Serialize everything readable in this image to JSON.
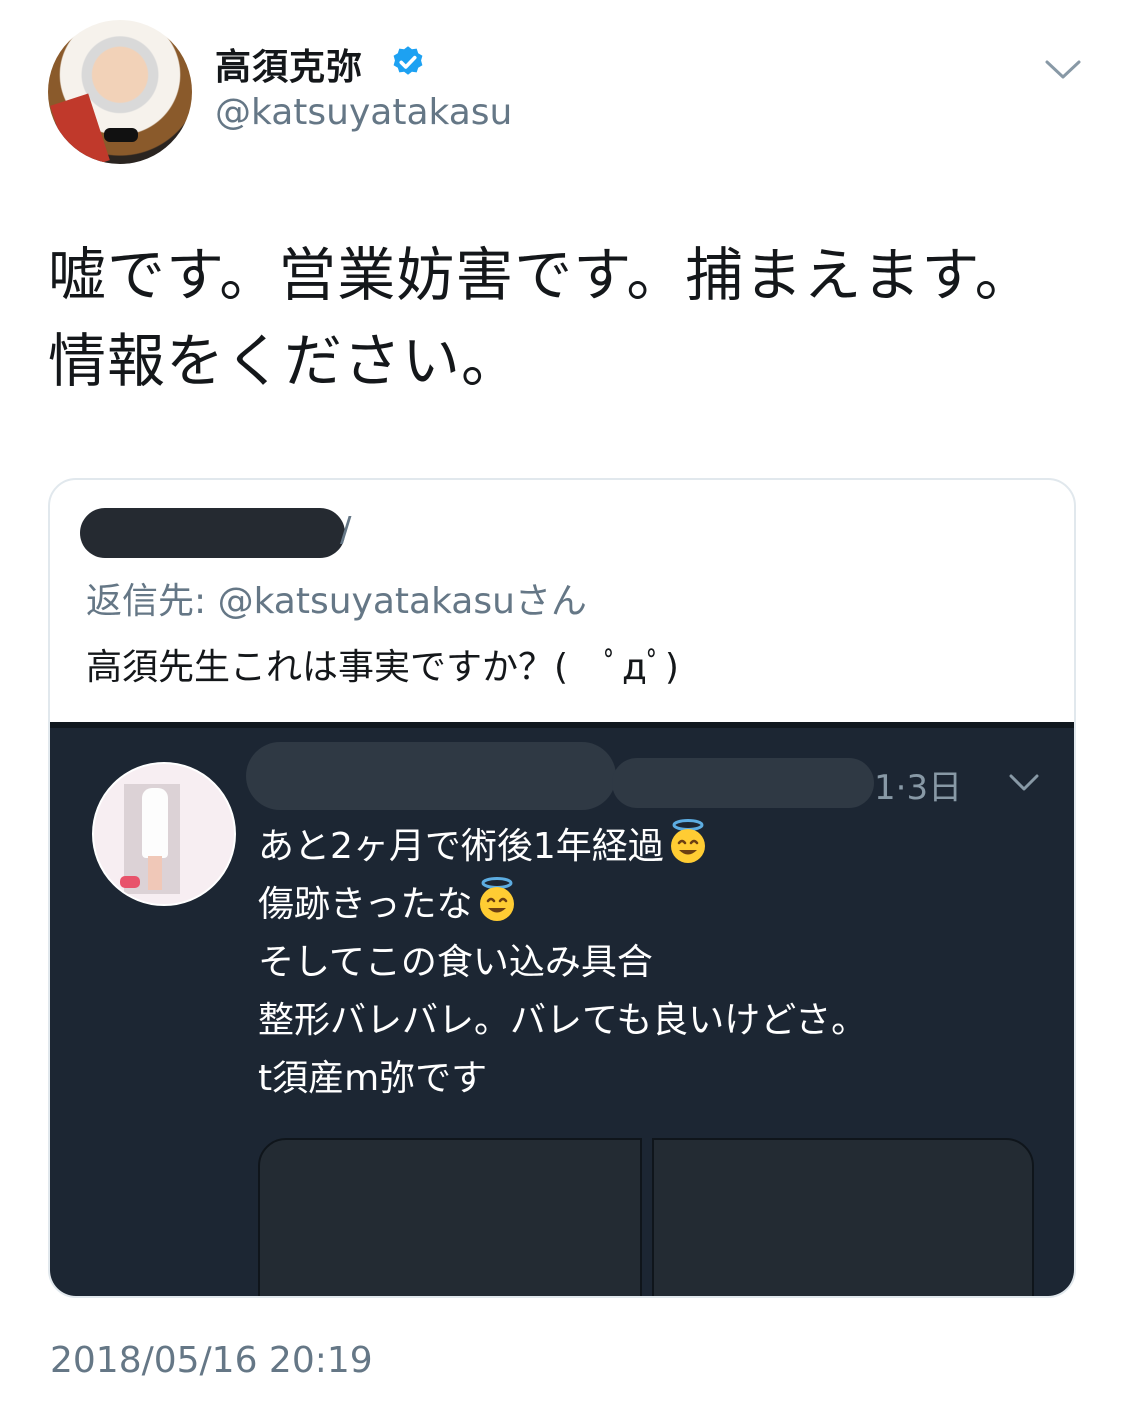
{
  "author": {
    "display_name": "高須克弥",
    "handle": "@katsuyatakasu",
    "verified": true,
    "avatar_icon": "profile-photo",
    "verified_icon": "verified-badge-icon",
    "menu_icon": "chevron-down-icon"
  },
  "tweet": {
    "text": "嘘です。営業妨害です。捕まえます。情報をください。",
    "timestamp": "2018/05/16 20:19"
  },
  "quoted": {
    "reply_to": "返信先: @katsuyatakasuさん",
    "text": "高須先生これは事実ですか？(　ﾟдﾟ)",
    "name_slash": "/",
    "embedded_post": {
      "meta": "1·3日",
      "lines": [
        "あと2ヶ月で術後1年経過",
        "傷跡きったな",
        "そしてこの食い込み具合",
        "整形バレバレ。バレても良いけどさ。",
        "t須産m弥です"
      ],
      "emoji": "smiling-face-with-halo"
    }
  },
  "colors": {
    "accent": "#1da1f2",
    "muted": "#657786",
    "dark_bg": "#1c2633"
  }
}
